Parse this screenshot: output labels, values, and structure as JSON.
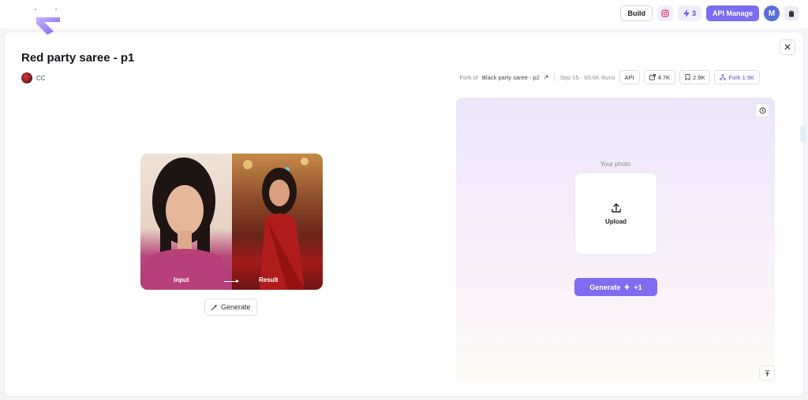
{
  "header": {
    "build_label": "Build",
    "credits_count": "3",
    "api_manage_label": "API Manage",
    "avatar_initial": "M"
  },
  "page": {
    "title": "Red party saree - p1",
    "author_name": "CC",
    "fork_prefix": "Fork of",
    "fork_source": "Black party saree - p2",
    "date_runs": "Sep 15 · 60.6K Runs",
    "api_label": "API",
    "shares_count": "4.7K",
    "saves_count": "2.9K",
    "fork_label": "Fork 1.9K",
    "close_label": "✕"
  },
  "preview": {
    "input_label": "Input",
    "result_label": "Result",
    "generate_label": "Generate"
  },
  "panel": {
    "your_photo_label": "Your photo",
    "upload_label": "Upload",
    "generate_label": "Generate",
    "generate_cost": "+1"
  },
  "colors": {
    "accent": "#7b6cf0",
    "accent_text": "#5b4ad8"
  }
}
